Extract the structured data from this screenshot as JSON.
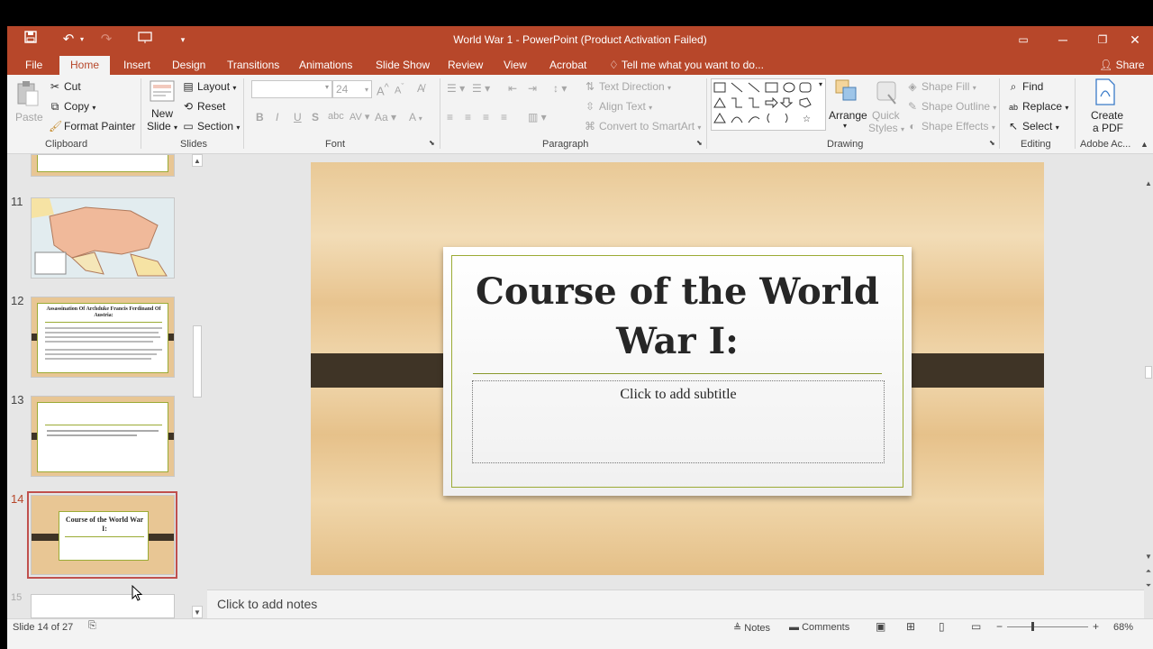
{
  "window": {
    "title": "World War 1 - PowerPoint (Product Activation Failed)"
  },
  "tabs": [
    "File",
    "Home",
    "Insert",
    "Design",
    "Transitions",
    "Animations",
    "Slide Show",
    "Review",
    "View",
    "Acrobat"
  ],
  "active_tab": "Home",
  "tell_me": "Tell me what you want to do...",
  "share": "Share",
  "ribbon": {
    "clipboard": {
      "paste": "Paste",
      "cut": "Cut",
      "copy": "Copy",
      "format_painter": "Format Painter",
      "label": "Clipboard"
    },
    "slides": {
      "new_slide_line1": "New",
      "new_slide_line2": "Slide",
      "layout": "Layout",
      "reset": "Reset",
      "section": "Section",
      "label": "Slides"
    },
    "font": {
      "font_name": "",
      "font_size": "24",
      "label": "Font"
    },
    "paragraph": {
      "text_direction": "Text Direction",
      "align_text": "Align Text",
      "convert_smartart": "Convert to SmartArt",
      "label": "Paragraph"
    },
    "drawing": {
      "arrange": "Arrange",
      "quick_styles_line1": "Quick",
      "quick_styles_line2": "Styles",
      "shape_fill": "Shape Fill",
      "shape_outline": "Shape Outline",
      "shape_effects": "Shape Effects",
      "label": "Drawing"
    },
    "editing": {
      "find": "Find",
      "replace": "Replace",
      "select": "Select",
      "label": "Editing"
    },
    "adobe": {
      "create_line1": "Create",
      "create_line2": "a PDF",
      "label": "Adobe Ac..."
    }
  },
  "thumbnails": [
    {
      "num": "11",
      "caption": ""
    },
    {
      "num": "12",
      "caption": "Assassination Of Archduke Francis Ferdinand Of Austria:"
    },
    {
      "num": "13",
      "caption": ""
    },
    {
      "num": "14",
      "caption": "Course of the World War I:"
    },
    {
      "num": "15",
      "caption": ""
    }
  ],
  "slide": {
    "title_line1": "Course of  the World",
    "title_line2": "War I:",
    "subtitle_placeholder": "Click to add subtitle"
  },
  "notes_placeholder": "Click to add notes",
  "status": {
    "slide_counter": "Slide 14 of 27",
    "notes": "Notes",
    "comments": "Comments",
    "zoom": "68%"
  },
  "colors": {
    "accent": "#b7472a",
    "slide_border": "#9bab35",
    "band": "#3f3426"
  }
}
